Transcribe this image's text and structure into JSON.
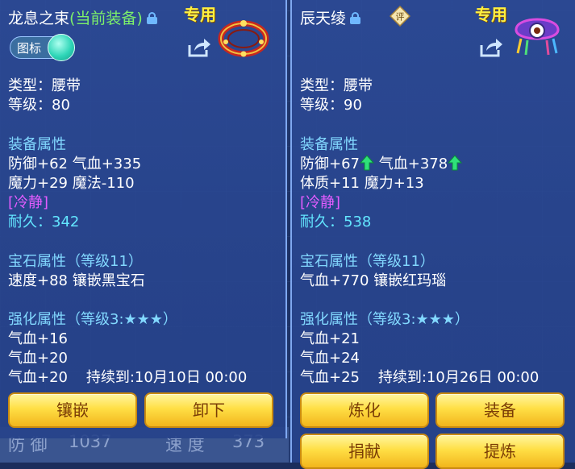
{
  "left": {
    "title": "龙息之束",
    "title_status": "(当前装备)",
    "exclusive": "专用",
    "toggle_label": "图标",
    "type": "类型：腰带",
    "level": "等级：80",
    "attr_header": "装备属性",
    "attr_lines": [
      "防御+62 气血+335",
      "魔力+29 魔法-110"
    ],
    "special": "[冷静]",
    "durability": "耐久：342",
    "gem_header": "宝石属性（等级11）",
    "gem_line": "速度+88 镶嵌黑宝石",
    "enhance_header": "强化属性（等级3:★★★）",
    "enhance_lines": [
      "气血+16",
      "气血+20",
      "气血+20    持续到:10月10日 00:00"
    ],
    "buttons": [
      "镶嵌",
      "卸下"
    ]
  },
  "right": {
    "title": "辰天绫",
    "badge": "评",
    "exclusive": "专用",
    "type": "类型：腰带",
    "level": "等级：90",
    "attr_header": "装备属性",
    "attr_parts": [
      "防御+67",
      "气血+378"
    ],
    "attr_line2": "体质+11 魔力+13",
    "special": "[冷静]",
    "durability": "耐久：538",
    "gem_header": "宝石属性（等级11）",
    "gem_line": "气血+770 镶嵌红玛瑙",
    "enhance_header": "强化属性（等级3:★★★）",
    "enhance_lines": [
      "气血+21",
      "气血+24",
      "气血+25    持续到:10月26日 00:00"
    ],
    "buttons": [
      "炼化",
      "装备",
      "捐献",
      "提炼"
    ]
  },
  "background": {
    "stat_label_1": "防 御",
    "stat_value_1": "1037",
    "stat_label_2": "速 度",
    "stat_value_2": "373"
  },
  "colors": {
    "heading": "#82d8ff",
    "special": "#e35cff",
    "durability": "#63e6ff",
    "exclusive": "#fff040",
    "current": "#7df06a",
    "button": "#ffdf45"
  },
  "icons": {
    "lock": "lock-icon",
    "share": "share-icon",
    "up": "up-arrow-icon"
  }
}
